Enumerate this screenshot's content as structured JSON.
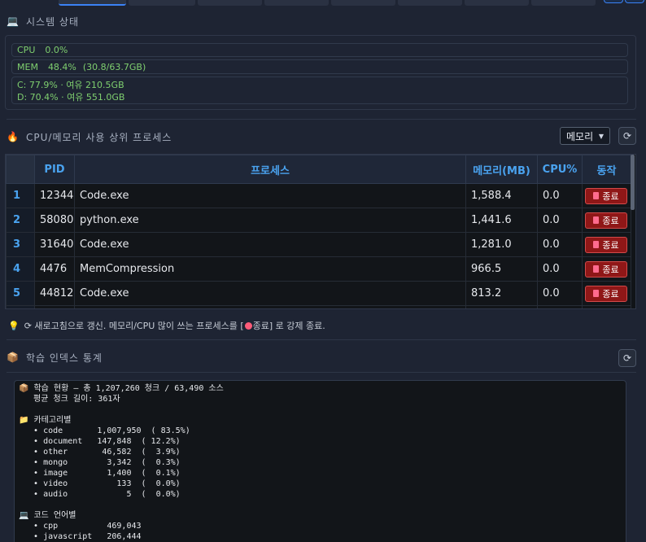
{
  "system_status": {
    "icon": "monitor-icon",
    "title": "시스템 상태",
    "cpu": {
      "label": "CPU",
      "value": "0.0%"
    },
    "mem": {
      "label": "MEM",
      "value": "48.4%",
      "detail": "(30.8/63.7GB)"
    },
    "disks": [
      "C: 77.9% · 여유 210.5GB",
      "D: 70.4% · 여유 551.0GB"
    ],
    "status_color": "#7fcf6f"
  },
  "top_processes": {
    "icon": "fire-icon",
    "title": "CPU/메모리 사용 상위 프로세스",
    "sort_select": {
      "selected": "메모리",
      "icon": "chevron-down-icon"
    },
    "refresh_icon": "refresh-icon",
    "columns": [
      "PID",
      "프로세스",
      "메모리(MB)",
      "CPU%",
      "동작"
    ],
    "rows": [
      {
        "num": "1",
        "pid": "12344",
        "name": "Code.exe",
        "mem": "1,588.4",
        "cpu": "0.0",
        "action": "종료"
      },
      {
        "num": "2",
        "pid": "58080",
        "name": "python.exe",
        "mem": "1,441.6",
        "cpu": "0.0",
        "action": "종료"
      },
      {
        "num": "3",
        "pid": "31640",
        "name": "Code.exe",
        "mem": "1,281.0",
        "cpu": "0.0",
        "action": "종료"
      },
      {
        "num": "4",
        "pid": "4476",
        "name": "MemCompression",
        "mem": "966.5",
        "cpu": "0.0",
        "action": "종료"
      },
      {
        "num": "5",
        "pid": "44812",
        "name": "Code.exe",
        "mem": "813.2",
        "cpu": "0.0",
        "action": "종료"
      }
    ],
    "hint": "⟳ 새로고침으로 갱신. 메모리/CPU 많이 쓰는 프로세스를 [",
    "hint_icon": "stop-icon",
    "hint_end": " 종료] 로 강제 종료.",
    "accent": "#4aa3f0",
    "kill_color": "#8f1717"
  },
  "index_stats": {
    "icon": "package-icon",
    "title": "학습 인덱스 통계",
    "refresh_icon": "refresh-icon",
    "lines": [
      "📦 학습 현황 — 총 1,207,260 청크 / 63,490 소스",
      "   평균 청크 길이: 361자",
      "",
      "📁 카테고리별",
      "   • code       1,007,950  ( 83.5%)",
      "   • document   147,848  ( 12.2%)",
      "   • other       46,582  (  3.9%)",
      "   • mongo        3,342  (  0.3%)",
      "   • image        1,400  (  0.1%)",
      "   • video          133  (  0.0%)",
      "   • audio            5  (  0.0%)",
      "",
      "💻 코드 언어별",
      "   • cpp          469,043",
      "   • javascript   206,444"
    ]
  }
}
